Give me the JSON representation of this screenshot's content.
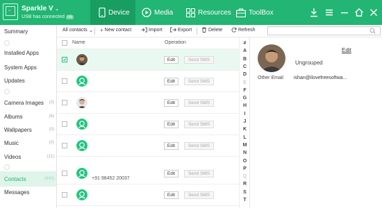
{
  "app": {
    "device_name": "Sparkle V",
    "device_status": "USB has connected",
    "device_badge": "0B",
    "device_icon": "phone-screen-icon"
  },
  "tabs": [
    {
      "label": "Device",
      "icon": "phone-icon",
      "active": true
    },
    {
      "label": "Media",
      "icon": "play-circle-icon",
      "active": false
    },
    {
      "label": "Resources",
      "icon": "grid-icon",
      "active": false
    },
    {
      "label": "ToolBox",
      "icon": "briefcase-icon",
      "active": false
    }
  ],
  "window_controls": [
    "download-icon",
    "menu-icon",
    "minimize-icon",
    "home-icon",
    "close-icon"
  ],
  "sidebar": {
    "items": [
      {
        "label": "Summary",
        "count": ""
      },
      {
        "label": "Installed Apps",
        "count": ""
      },
      {
        "label": "System Apps",
        "count": ""
      },
      {
        "label": "Updates",
        "count": ""
      },
      {
        "label": "Camera Images",
        "count": "(3)"
      },
      {
        "label": "Albums",
        "count": "(6)"
      },
      {
        "label": "Wallpapers",
        "count": "(0)"
      },
      {
        "label": "Music",
        "count": "(0)"
      },
      {
        "label": "Videos",
        "count": "(11)"
      },
      {
        "label": "Contacts",
        "count": "(640)",
        "active": true
      },
      {
        "label": "Messages",
        "count": ""
      }
    ]
  },
  "toolbar": {
    "filter_label": "All contacts",
    "new_label": "New contact",
    "import_label": "Import",
    "export_label": "Export",
    "delete_label": "Delete",
    "refresh_label": "Refresh",
    "search_placeholder": ""
  },
  "list": {
    "header_name": "Name",
    "header_operation": "Operation",
    "edit_label": "Edit",
    "sms_label": "Send SMS",
    "rows": [
      {
        "phone": "",
        "avatar": "photo",
        "selected": true
      },
      {
        "phone": "",
        "avatar": "default",
        "selected": false
      },
      {
        "phone": "",
        "avatar": "photo2",
        "selected": false
      },
      {
        "phone": "",
        "avatar": "default",
        "selected": false
      },
      {
        "phone": "",
        "avatar": "default",
        "selected": false
      },
      {
        "phone": "+91 98452 20037",
        "avatar": "default",
        "selected": false
      },
      {
        "phone": "",
        "avatar": "default",
        "selected": false
      }
    ]
  },
  "alphabet": [
    "#",
    "A",
    "B",
    "C",
    "D",
    "E",
    "F",
    "G",
    "H",
    "I",
    "J",
    "K",
    "L",
    "M",
    "N",
    "O",
    "P",
    "Q",
    "R",
    "S",
    "T"
  ],
  "alphabet_dimmed": [
    "E",
    "Q"
  ],
  "detail": {
    "edit_label": "Edit",
    "group": "Ungrouped",
    "other_email_label": "Other Email",
    "other_email_value": "ishan@ilovefreesoftwa..."
  },
  "colors": {
    "accent": "#22b573",
    "accent_dark": "#189e61",
    "selected_bg": "#e9f9f1"
  }
}
